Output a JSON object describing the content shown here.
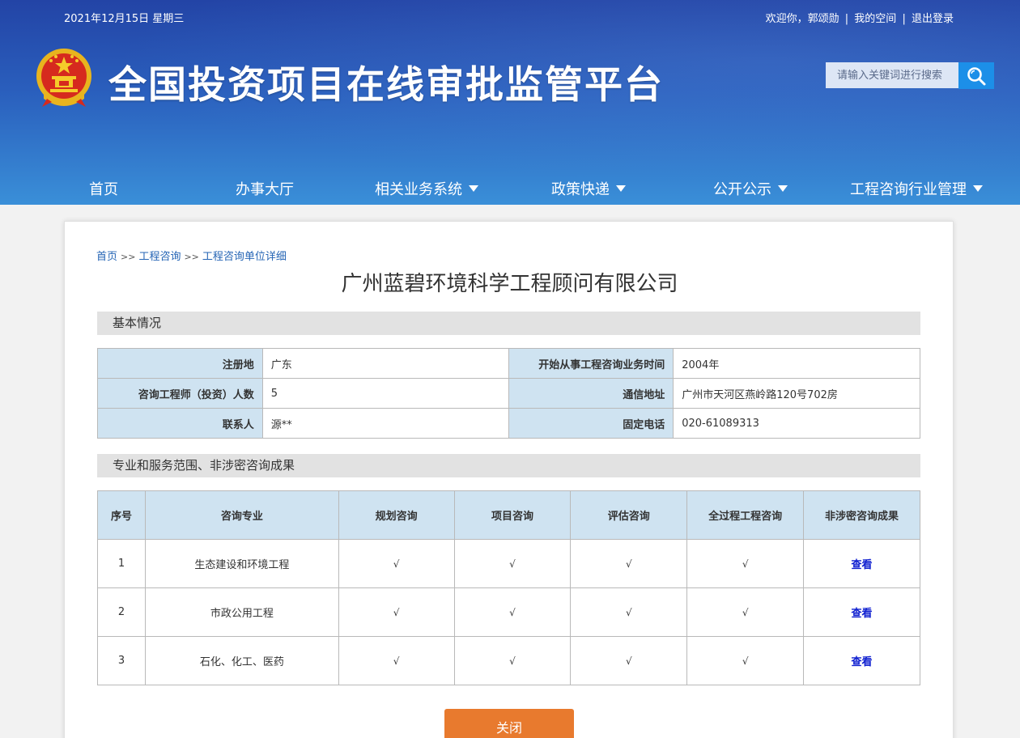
{
  "topbar": {
    "date": "2021年12月15日 星期三",
    "welcome": "欢迎你，郭颂勋",
    "my_space": "我的空间",
    "logout": "退出登录",
    "separator": "|"
  },
  "header": {
    "site_title": "全国投资项目在线审批监管平台",
    "search_placeholder": "请输入关键词进行搜索",
    "emblem_icon": "national-emblem-icon"
  },
  "nav": {
    "items": [
      {
        "label": "首页",
        "has_dropdown": false
      },
      {
        "label": "办事大厅",
        "has_dropdown": false
      },
      {
        "label": "相关业务系统",
        "has_dropdown": true
      },
      {
        "label": "政策快递",
        "has_dropdown": true
      },
      {
        "label": "公开公示",
        "has_dropdown": true
      },
      {
        "label": "工程咨询行业管理",
        "has_dropdown": true
      }
    ]
  },
  "breadcrumb": {
    "items": [
      "首页",
      "工程咨询",
      "工程咨询单位详细"
    ],
    "separator": ">>"
  },
  "company_name": "广州蓝碧环境科学工程顾问有限公司",
  "basic_info": {
    "section_title": "基本情况",
    "rows": [
      [
        {
          "label": "注册地",
          "value": "广东"
        },
        {
          "label": "开始从事工程咨询业务时间",
          "value": "2004年"
        }
      ],
      [
        {
          "label": "咨询工程师（投资）人数",
          "value": "5"
        },
        {
          "label": "通信地址",
          "value": "广州市天河区燕岭路120号702房"
        }
      ],
      [
        {
          "label": "联系人",
          "value": "源**"
        },
        {
          "label": "固定电话",
          "value": "020-61089313"
        }
      ]
    ]
  },
  "services": {
    "section_title": "专业和服务范围、非涉密咨询成果",
    "headers": [
      "序号",
      "咨询专业",
      "规划咨询",
      "项目咨询",
      "评估咨询",
      "全过程工程咨询",
      "非涉密咨询成果"
    ],
    "rows": [
      {
        "no": "1",
        "specialty": "生态建设和环境工程",
        "planning": "√",
        "project": "√",
        "evaluation": "√",
        "whole_process": "√",
        "result_link": "查看"
      },
      {
        "no": "2",
        "specialty": "市政公用工程",
        "planning": "√",
        "project": "√",
        "evaluation": "√",
        "whole_process": "√",
        "result_link": "查看"
      },
      {
        "no": "3",
        "specialty": "石化、化工、医药",
        "planning": "√",
        "project": "√",
        "evaluation": "√",
        "whole_process": "√",
        "result_link": "查看"
      }
    ]
  },
  "close_button": "关闭",
  "colors": {
    "header_top": "#2344a6",
    "header_bottom": "#3a8fd8",
    "search_button": "#1c8fe8",
    "label_cell_bg": "#cfe3f1",
    "close_button_bg": "#e87a2e",
    "link_color": "#1020d0"
  }
}
